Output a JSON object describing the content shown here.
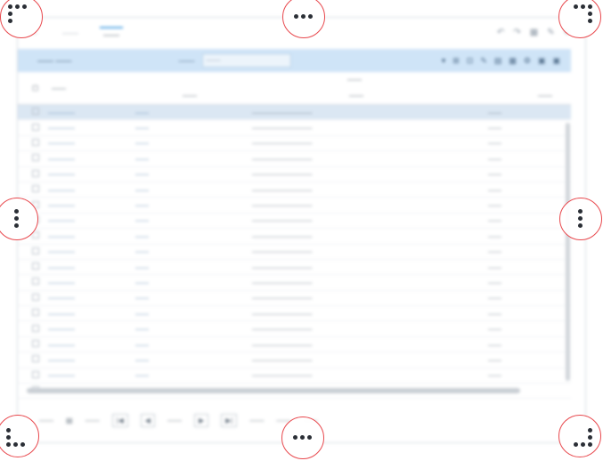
{
  "tabs": [
    "——",
    "——",
    "——"
  ],
  "header": {
    "title": "——  ——",
    "search_label": "——",
    "search_placeholder": "——",
    "tools": [
      "▾",
      "⊞",
      "⊡",
      "✎",
      "▤",
      "▦",
      "⚙",
      "▣",
      "▣"
    ]
  },
  "table": {
    "columns": {
      "check": "☐",
      "code": "——",
      "group": "——",
      "brand": "——",
      "desc": "——",
      "size": "——"
    },
    "rows": [
      {
        "code": "————",
        "brand": "——",
        "desc": "—————————",
        "size": "——"
      },
      {
        "code": "————",
        "brand": "——",
        "desc": "—————————",
        "size": "——"
      },
      {
        "code": "————",
        "brand": "——",
        "desc": "—————————",
        "size": "——"
      },
      {
        "code": "————",
        "brand": "——",
        "desc": "—————————",
        "size": "——"
      },
      {
        "code": "————",
        "brand": "——",
        "desc": "—————————",
        "size": "——"
      },
      {
        "code": "————",
        "brand": "——",
        "desc": "—————————",
        "size": "——"
      },
      {
        "code": "————",
        "brand": "——",
        "desc": "—————————",
        "size": "——"
      },
      {
        "code": "————",
        "brand": "——",
        "desc": "—————————",
        "size": "——"
      },
      {
        "code": "————",
        "brand": "——",
        "desc": "—————————",
        "size": "——"
      },
      {
        "code": "————",
        "brand": "——",
        "desc": "—————————",
        "size": "——"
      },
      {
        "code": "————",
        "brand": "——",
        "desc": "—————————",
        "size": "——"
      },
      {
        "code": "————",
        "brand": "——",
        "desc": "—————————",
        "size": "——"
      },
      {
        "code": "————",
        "brand": "——",
        "desc": "—————————",
        "size": "——"
      },
      {
        "code": "————",
        "brand": "——",
        "desc": "—————————",
        "size": "——"
      },
      {
        "code": "————",
        "brand": "——",
        "desc": "—————————",
        "size": "——"
      },
      {
        "code": "————",
        "brand": "——",
        "desc": "—————————",
        "size": "——"
      },
      {
        "code": "————",
        "brand": "——",
        "desc": "—————————",
        "size": "——"
      },
      {
        "code": "————",
        "brand": "——",
        "desc": "—————————",
        "size": "——"
      },
      {
        "code": "————",
        "brand": "——",
        "desc": "—————————",
        "size": "——"
      }
    ]
  },
  "pager": {
    "items": [
      "——",
      "▤",
      "——",
      "|◀",
      "◀",
      "——",
      "▶",
      "▶|",
      "——",
      "——",
      "——"
    ]
  },
  "handles": [
    "top-left",
    "top",
    "top-right",
    "left",
    "right",
    "bottom-left",
    "bottom",
    "bottom-right"
  ],
  "colors": {
    "header_bg": "#cfe4f7",
    "selected_row": "#dbe7f3",
    "handle_ring": "#e8484d",
    "handle_dot": "#2b2f36"
  }
}
